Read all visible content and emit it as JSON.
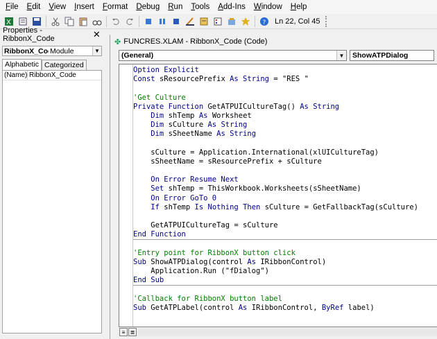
{
  "menubar": {
    "items": [
      "File",
      "Edit",
      "View",
      "Insert",
      "Format",
      "Debug",
      "Run",
      "Tools",
      "Add-Ins",
      "Window",
      "Help"
    ]
  },
  "toolbar": {
    "status": "Ln 22, Col 45",
    "icons": [
      "excel-icon",
      "insert-icon",
      "save-icon",
      "cut-icon",
      "copy-icon",
      "paste-icon",
      "find-icon",
      "undo-icon",
      "redo-icon",
      "run-icon",
      "break-icon",
      "reset-icon",
      "design-mode-icon",
      "project-explorer-icon",
      "properties-icon",
      "object-browser-icon",
      "toolbox-icon",
      "help-icon"
    ]
  },
  "properties": {
    "title": "Properties - RibbonX_Code",
    "object_name": "RibbonX_Cod",
    "object_type": "Module",
    "tabs": [
      "Alphabetic",
      "Categorized"
    ],
    "rows": [
      {
        "name": "(Name)",
        "value": "RibbonX_Code"
      }
    ]
  },
  "codewindow": {
    "title": "FUNCRES.XLAM - RibbonX_Code (Code)",
    "object_combo": "(General)",
    "proc_combo": "ShowATPDialog",
    "lines": [
      [
        {
          "t": "Option Explicit",
          "c": "kw"
        }
      ],
      [
        {
          "t": "Const ",
          "c": "kw"
        },
        {
          "t": "sResourcePrefix ",
          "c": "tx"
        },
        {
          "t": "As String",
          "c": "kw"
        },
        {
          "t": " = \"RES \"",
          "c": "tx"
        }
      ],
      [],
      [
        {
          "t": "'Get Culture",
          "c": "cm"
        }
      ],
      [
        {
          "t": "Private Function ",
          "c": "kw"
        },
        {
          "t": "GetATPUICultureTag() ",
          "c": "tx"
        },
        {
          "t": "As String",
          "c": "kw"
        }
      ],
      [
        {
          "t": "    Dim ",
          "c": "kw"
        },
        {
          "t": "shTemp ",
          "c": "tx"
        },
        {
          "t": "As ",
          "c": "kw"
        },
        {
          "t": "Worksheet",
          "c": "tx"
        }
      ],
      [
        {
          "t": "    Dim ",
          "c": "kw"
        },
        {
          "t": "sCulture ",
          "c": "tx"
        },
        {
          "t": "As String",
          "c": "kw"
        }
      ],
      [
        {
          "t": "    Dim ",
          "c": "kw"
        },
        {
          "t": "sSheetName ",
          "c": "tx"
        },
        {
          "t": "As String",
          "c": "kw"
        }
      ],
      [],
      [
        {
          "t": "    sCulture = Application.International(xlUICultureTag)",
          "c": "tx"
        }
      ],
      [
        {
          "t": "    sSheetName = sResourcePrefix + sCulture",
          "c": "tx"
        }
      ],
      [],
      [
        {
          "t": "    On Error Resume Next",
          "c": "kw"
        }
      ],
      [
        {
          "t": "    Set ",
          "c": "kw"
        },
        {
          "t": "shTemp = ThisWorkbook.Worksheets(sSheetName)",
          "c": "tx"
        }
      ],
      [
        {
          "t": "    On Error GoTo 0",
          "c": "kw"
        }
      ],
      [
        {
          "t": "    If ",
          "c": "kw"
        },
        {
          "t": "shTemp ",
          "c": "tx"
        },
        {
          "t": "Is Nothing Then ",
          "c": "kw"
        },
        {
          "t": "sCulture = GetFallbackTag(sCulture)",
          "c": "tx"
        }
      ],
      [],
      [
        {
          "t": "    GetATPUICultureTag = sCulture",
          "c": "tx"
        }
      ],
      [
        {
          "t": "End Function",
          "c": "kw"
        }
      ],
      [],
      [
        {
          "t": "'Entry point for RibbonX button click",
          "c": "cm"
        }
      ],
      [
        {
          "t": "Sub ",
          "c": "kw"
        },
        {
          "t": "ShowATPDialog(control ",
          "c": "tx"
        },
        {
          "t": "As ",
          "c": "kw"
        },
        {
          "t": "IRibbonControl)",
          "c": "tx"
        }
      ],
      [
        {
          "t": "    Application.Run (\"fDialog\")",
          "c": "tx"
        }
      ],
      [
        {
          "t": "End Sub",
          "c": "kw"
        }
      ],
      [],
      [
        {
          "t": "'Callback for RibbonX button label",
          "c": "cm"
        }
      ],
      [
        {
          "t": "Sub ",
          "c": "kw"
        },
        {
          "t": "GetATPLabel(control ",
          "c": "tx"
        },
        {
          "t": "As ",
          "c": "kw"
        },
        {
          "t": "IRibbonControl, ",
          "c": "tx"
        },
        {
          "t": "ByRef ",
          "c": "kw"
        },
        {
          "t": "label)",
          "c": "tx"
        }
      ]
    ]
  }
}
